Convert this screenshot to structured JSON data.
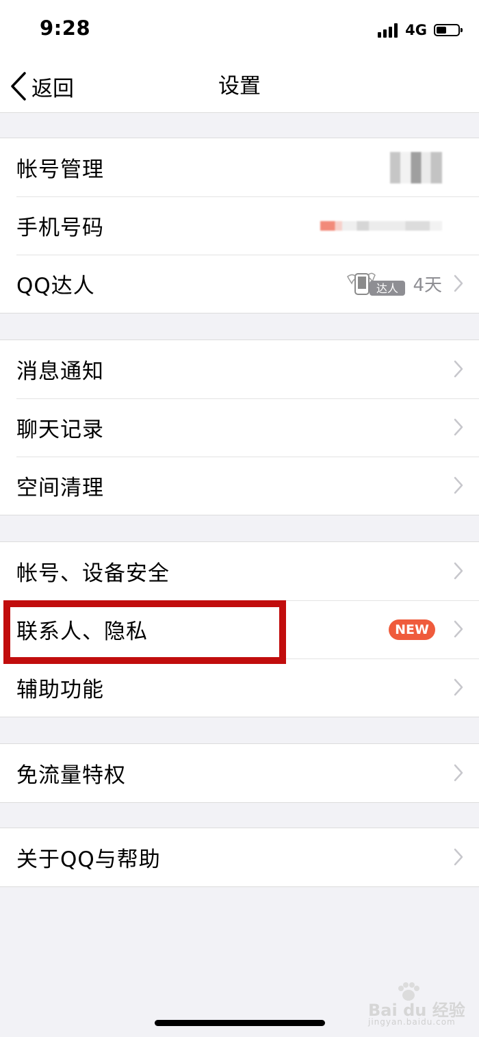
{
  "status_bar": {
    "time": "9:28",
    "network": "4G",
    "battery_level": 0.45
  },
  "nav": {
    "back_label": "返回",
    "title": "设置"
  },
  "groups": [
    {
      "items": [
        {
          "label": "帐号管理"
        },
        {
          "label": "手机号码"
        },
        {
          "label": "QQ达人",
          "badge_text": "达人",
          "value": "4天"
        }
      ]
    },
    {
      "items": [
        {
          "label": "消息通知"
        },
        {
          "label": "聊天记录"
        },
        {
          "label": "空间清理"
        }
      ]
    },
    {
      "items": [
        {
          "label": "帐号、设备安全"
        },
        {
          "label": "联系人、隐私",
          "badge": "NEW"
        },
        {
          "label": "辅助功能"
        }
      ]
    },
    {
      "items": [
        {
          "label": "免流量特权"
        }
      ]
    },
    {
      "items": [
        {
          "label": "关于QQ与帮助"
        }
      ]
    }
  ],
  "watermark": {
    "text": "Bai du 经验",
    "sub": "jingyan.baidu.com"
  },
  "colors": {
    "highlight": "#c10d0d",
    "new_badge": "#ef5b3c",
    "background": "#f2f2f6"
  }
}
